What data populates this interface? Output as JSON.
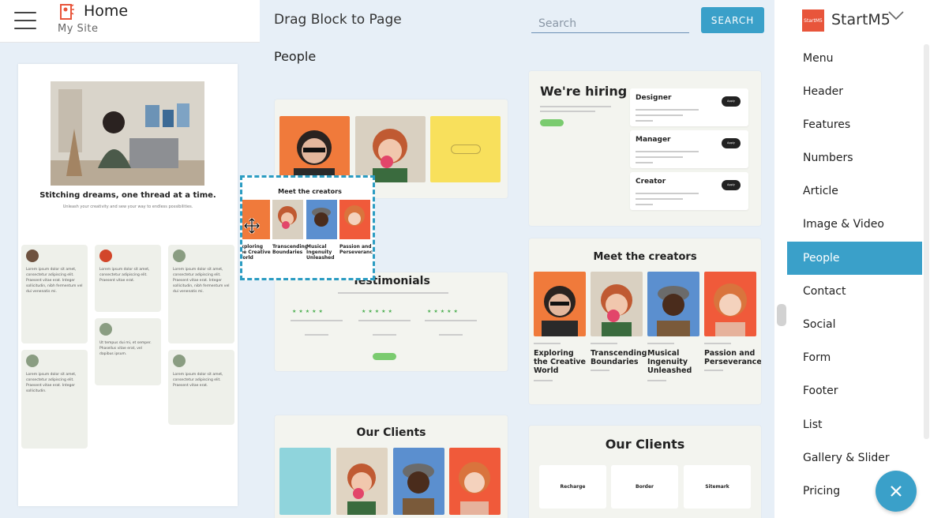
{
  "header": {
    "home_title": "Home",
    "site_subtitle": "My Site",
    "drag_title": "Drag Block to Page",
    "search_placeholder": "Search",
    "search_button": "SEARCH",
    "brand_name": "StartM5",
    "brand_logo_text": "StartM5"
  },
  "gallery": {
    "section_label": "People",
    "hiring": {
      "title": "We're hiring",
      "jobs": [
        "Designer",
        "Manager",
        "Creator"
      ],
      "apply": "Apply"
    },
    "creators_small": {
      "title": "Meet the creators",
      "names": [
        "Exploring the Creative World",
        "Transcending Boundaries",
        "Musical Ingenuity Unleashed",
        "Passion and Perseverance"
      ]
    },
    "creators_large": {
      "title": "Meet the creators",
      "names": [
        "Exploring the Creative World",
        "Transcending Boundaries",
        "Musical Ingenuity Unleashed",
        "Passion and Perseverance"
      ]
    },
    "testimonials_title": "Testimonials",
    "clients_title_a": "Our Clients",
    "clients_title_b": "Our Clients",
    "client_logos": [
      "Recharge",
      "Border",
      "Sitemark"
    ]
  },
  "preview": {
    "hero_title": "Stitching dreams, one thread at a time.",
    "hero_subtitle": "Unleash your creativity and sew your way to endless possibilities."
  },
  "menu": {
    "items": [
      "Menu",
      "Header",
      "Features",
      "Numbers",
      "Article",
      "Image & Video",
      "People",
      "Contact",
      "Social",
      "Form",
      "Footer",
      "List",
      "Gallery & Slider",
      "Pricing"
    ],
    "active": "People"
  },
  "colors": {
    "accent": "#3aa0c9",
    "panel_bg": "#e7eff7",
    "brand": "#e8553b"
  }
}
